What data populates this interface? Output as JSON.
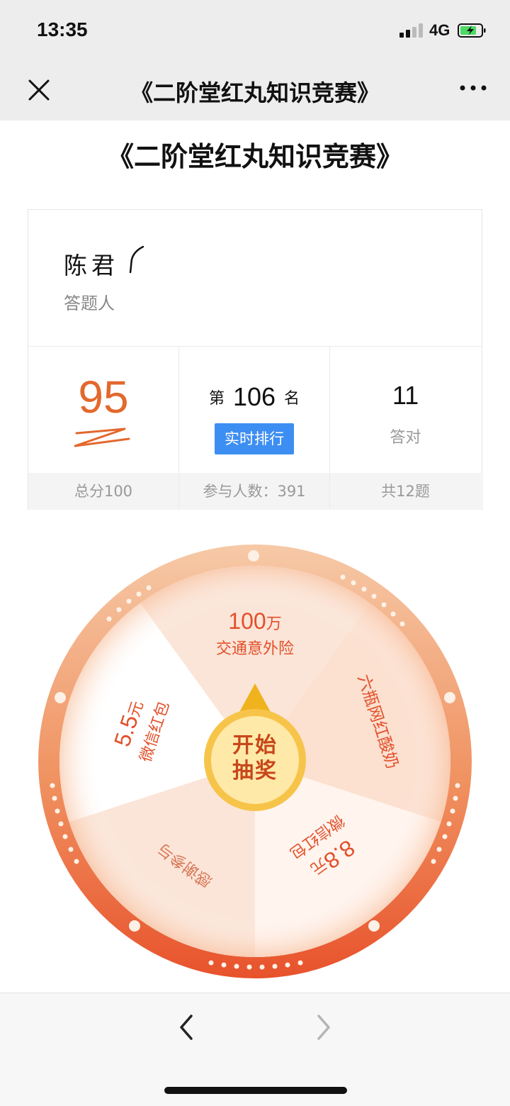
{
  "status_bar": {
    "time": "13:35",
    "network": "4G"
  },
  "nav": {
    "title": "《二阶堂红丸知识竞赛》"
  },
  "page": {
    "title": "《二阶堂红丸知识竞赛》"
  },
  "participant": {
    "name": "陈君",
    "role": "答题人"
  },
  "stats": {
    "score": "95",
    "score_footer": "总分100",
    "rank_prefix": "第",
    "rank": "106",
    "rank_suffix": "名",
    "rank_button": "实时排行",
    "rank_footer": "参与人数：391",
    "correct": "11",
    "correct_label": "答对",
    "correct_footer": "共12题"
  },
  "wheel": {
    "segments": [
      {
        "value": "100",
        "unit": "万",
        "label": "交通意外险"
      },
      {
        "label": "六瓶网红酸奶"
      },
      {
        "value": "8.8",
        "unit": "元",
        "label": "微信红包"
      },
      {
        "label": "感谢参与"
      },
      {
        "value": "5.5",
        "unit": "元",
        "label": "微信红包"
      }
    ],
    "start_line1": "开始",
    "start_line2": "抽奖"
  },
  "colors": {
    "accent": "#e3682d",
    "rank_button": "#3d8ef2",
    "wheel_rim": "#ee7a46"
  }
}
